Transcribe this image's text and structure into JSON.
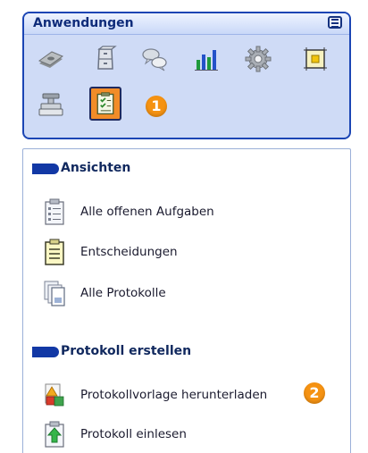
{
  "apps": {
    "title": "Anwendungen",
    "icons": [
      "money-icon",
      "cabinet-icon",
      "chat-bubbles-icon",
      "bar-chart-icon",
      "gear-icon",
      "frame-icon",
      "stamp-icon",
      "checklist-icon"
    ],
    "selected": "checklist-icon",
    "callout_1": "1"
  },
  "views": {
    "section_title": "Ansichten",
    "items": [
      {
        "label": "Alle offenen Aufgaben",
        "icon": "task-list-icon"
      },
      {
        "label": "Entscheidungen",
        "icon": "decision-document-icon"
      },
      {
        "label": "Alle Protokolle",
        "icon": "documents-stack-icon"
      }
    ]
  },
  "protocol": {
    "section_title": "Protokoll erstellen",
    "items": [
      {
        "label": "Protokollvorlage herunterladen",
        "icon": "template-download-icon"
      },
      {
        "label": "Protokoll einlesen",
        "icon": "upload-document-icon"
      }
    ],
    "callout_2": "2"
  },
  "colors": {
    "panel_border": "#1b45b4",
    "panel_bg": "#cfdbf6",
    "section_pill": "#1238a5",
    "badge": "#f59212",
    "selected_bg": "#f28c28"
  }
}
